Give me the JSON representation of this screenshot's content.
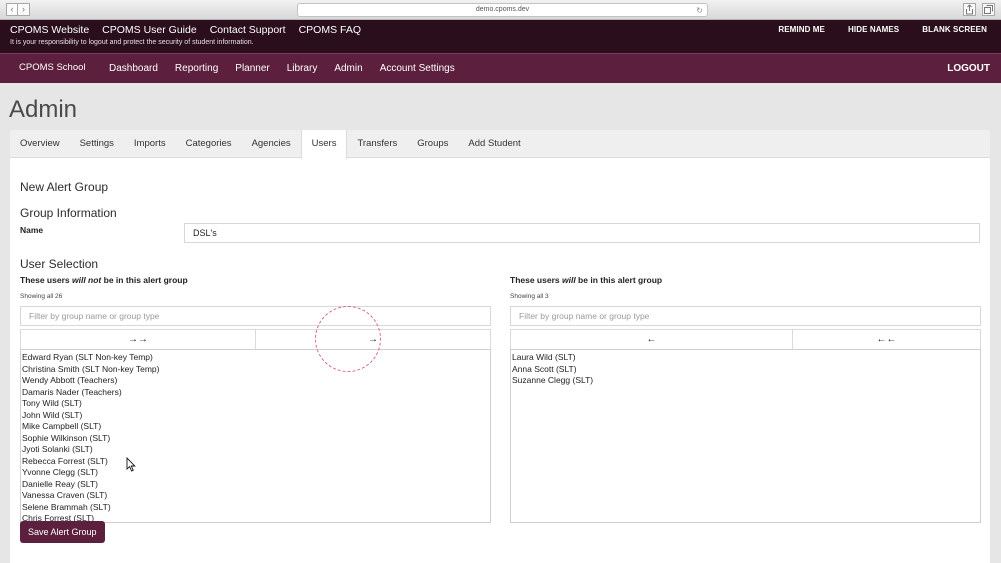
{
  "browser": {
    "url": "demo.cpoms.dev",
    "back_glyph": "‹",
    "forward_glyph": "›",
    "reload_glyph": "↻"
  },
  "topbar": {
    "links": [
      "CPOMS Website",
      "CPOMS User Guide",
      "Contact Support",
      "CPOMS FAQ"
    ],
    "notice": "It is your responsibility to logout and protect the security of student information.",
    "right": [
      "REMIND ME",
      "HIDE NAMES",
      "BLANK SCREEN"
    ]
  },
  "nav": {
    "brand": "CPOMS School",
    "items": [
      "Dashboard",
      "Reporting",
      "Planner",
      "Library",
      "Admin",
      "Account Settings"
    ],
    "logout": "LOGOUT"
  },
  "page": {
    "title": "Admin"
  },
  "tabs": {
    "items": [
      "Overview",
      "Settings",
      "Imports",
      "Categories",
      "Agencies",
      "Users",
      "Transfers",
      "Groups",
      "Add Student"
    ],
    "active": "Users"
  },
  "form": {
    "heading": "New Alert Group",
    "group_info": "Group Information",
    "name_label": "Name",
    "name_value": "DSL's",
    "user_selection": "User Selection",
    "left": {
      "caption_pre": "These users ",
      "caption_em": "will not",
      "caption_post": " be in this alert group",
      "showing": "Showing all 26",
      "filter_placeholder": "Filter by group name or group type",
      "btn_all": "→→",
      "btn_one": "→",
      "users": [
        "Edward Ryan (SLT Non-key Temp)",
        "Christina Smith (SLT Non-key Temp)",
        "Wendy Abbott (Teachers)",
        "Damaris Nader (Teachers)",
        "Tony Wild (SLT)",
        "John Wild (SLT)",
        "Mike Campbell (SLT)",
        "Sophie Wilkinson (SLT)",
        "Jyoti Solanki (SLT)",
        "Rebecca Forrest (SLT)",
        "Yvonne Clegg (SLT)",
        "Danielle Reay (SLT)",
        "Vanessa Craven (SLT)",
        "Selene Brammah (SLT)",
        "Chris Forrest (SLT)"
      ]
    },
    "right": {
      "caption_pre": "These users ",
      "caption_em": "will",
      "caption_post": " be in this alert group",
      "showing": "Showing all 3",
      "filter_placeholder": "Filter by group name or group type",
      "btn_one": "←",
      "btn_all": "←←",
      "users": [
        "Laura Wild (SLT)",
        "Anna Scott (SLT)",
        "Suzanne Clegg (SLT)"
      ]
    },
    "save_label": "Save Alert Group"
  },
  "colors": {
    "topbar": "#2a0e1b",
    "nav": "#5c1f3d",
    "button": "#5c1f3d",
    "highlight_circle": "#d9668e"
  }
}
